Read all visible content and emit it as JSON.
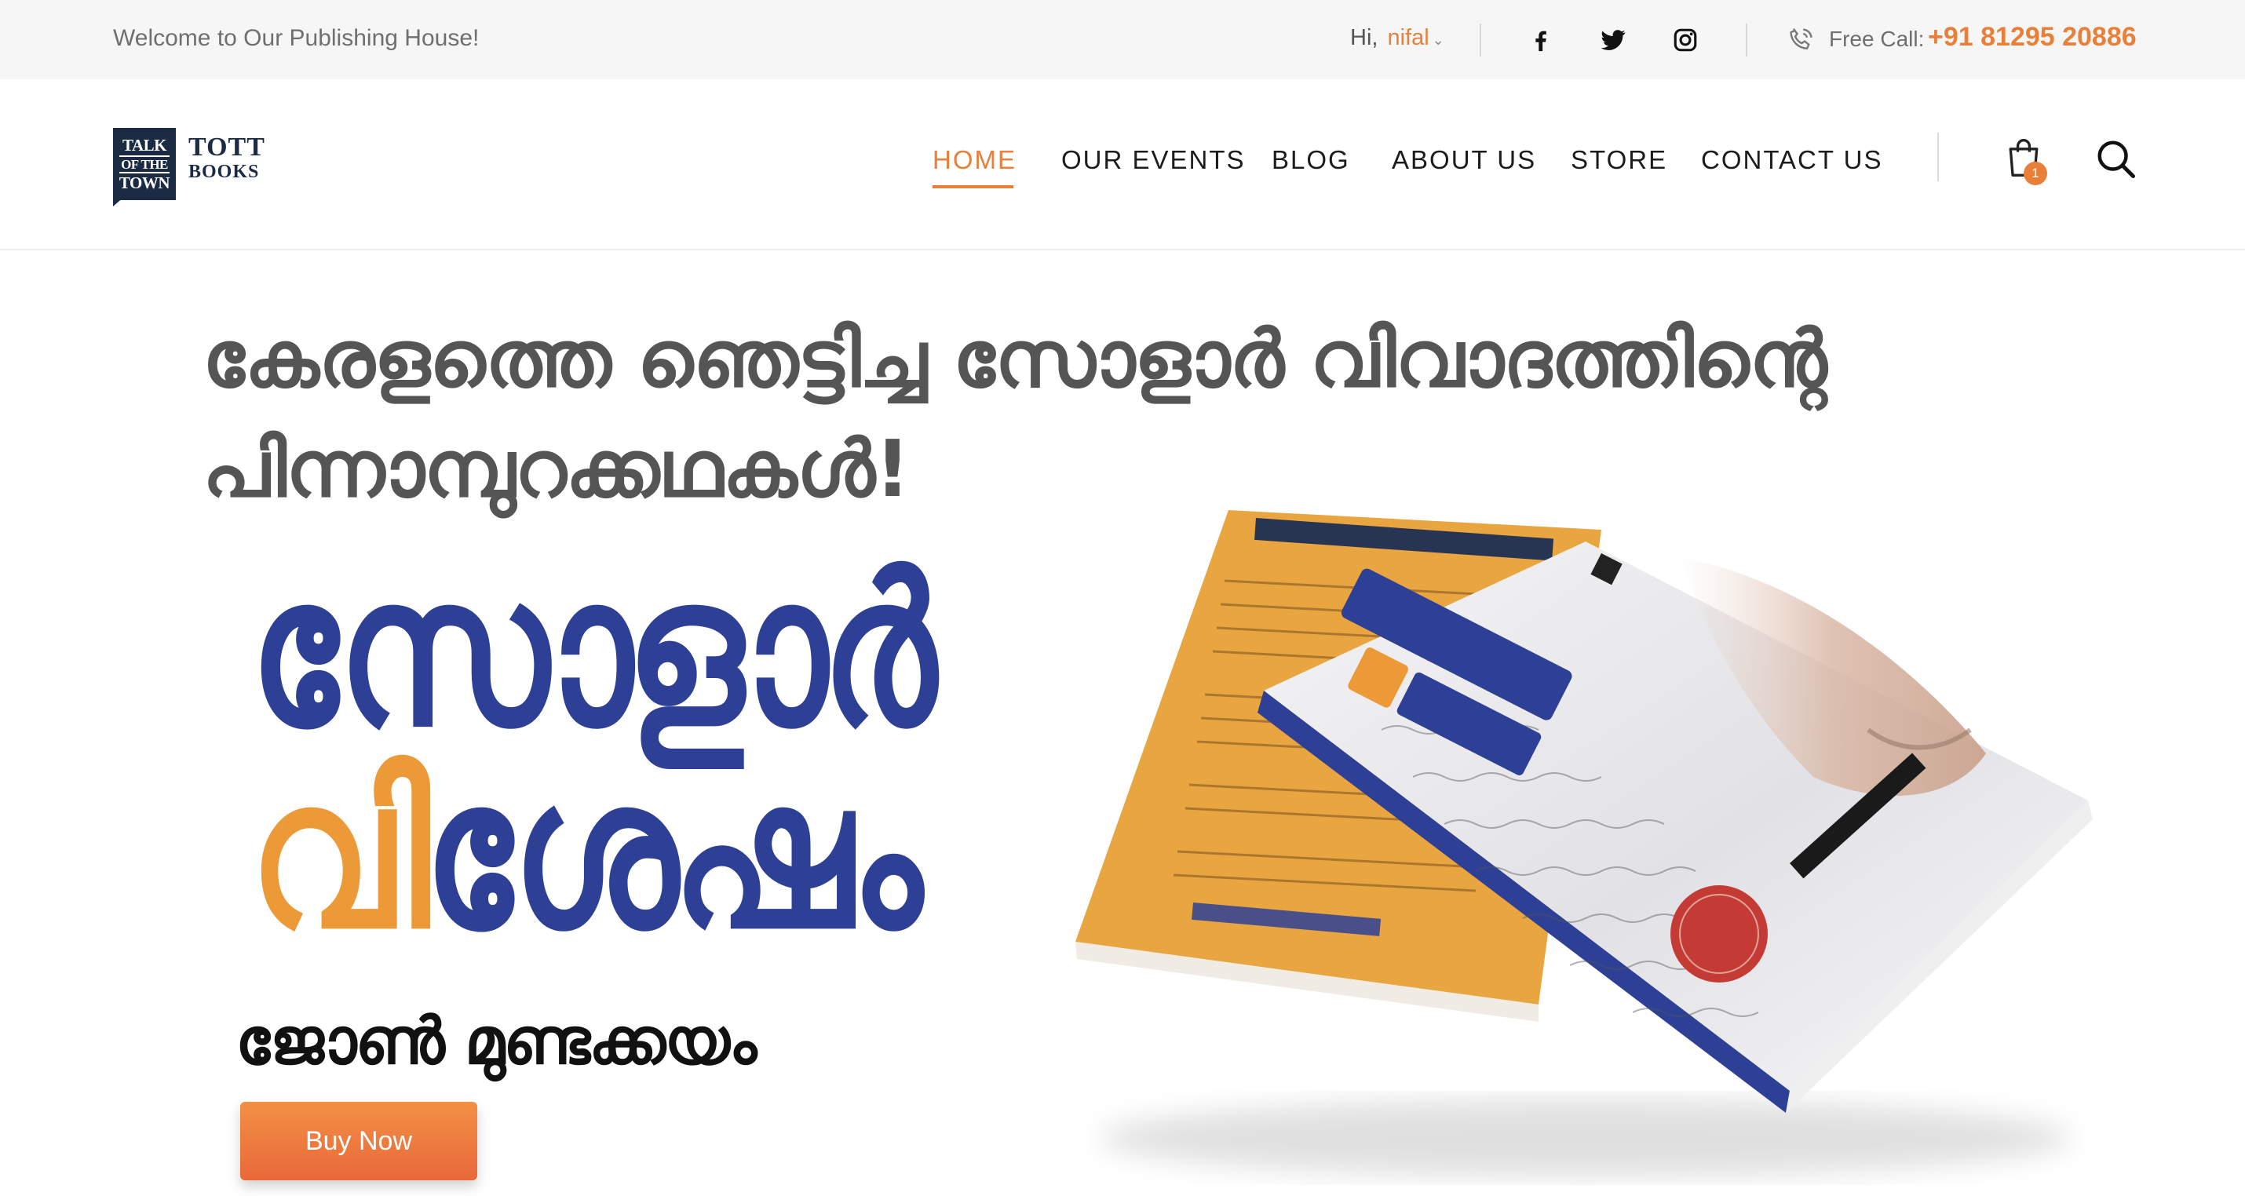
{
  "topbar": {
    "welcome": "Welcome to Our Publishing House!",
    "greeting": "Hi,",
    "username": "nifal",
    "free_call_label": "Free Call:",
    "phone": "+91 81295 20886",
    "social_icons": [
      "facebook-icon",
      "twitter-icon",
      "instagram-icon"
    ]
  },
  "logo": {
    "badge_lines": [
      "TALK",
      "OF THE",
      "TOWN"
    ],
    "name_line1": "TOTT",
    "name_line2": "BOOKS"
  },
  "nav": {
    "items": [
      "HOME",
      "OUR EVENTS",
      "BLOG",
      "ABOUT US",
      "STORE",
      "CONTACT US"
    ],
    "active": "HOME",
    "cart_count": "1"
  },
  "hero": {
    "headline_line1": "കേരളത്തെ ഞെട്ടിച്ച സോളാർ വിവാദത്തിന്റെ",
    "headline_line2": "പിന്നാമ്പുറക്കഥകൾ!",
    "title_line1": "സോളാർ",
    "title_line2_accent": "വി",
    "title_line2_rest": "ശേഷം",
    "author": "ജോൺ മുണ്ടക്കയം",
    "buy_button": "Buy Now"
  },
  "colors": {
    "accent": "#e8803a",
    "title_blue": "#2d4096",
    "title_orange": "#ec9a37",
    "nav_dark": "#1b2b44"
  }
}
